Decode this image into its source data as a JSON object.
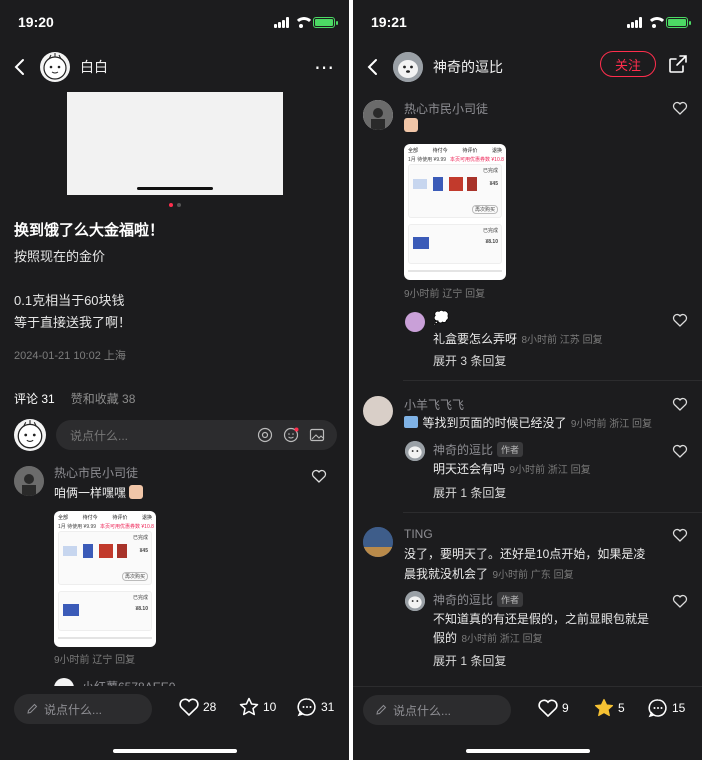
{
  "left": {
    "status": {
      "time": "19:20"
    },
    "nav": {
      "username": "白白"
    },
    "post": {
      "title": "换到饿了么大金福啦！",
      "lines": [
        "按照现在的金价",
        "",
        "0.1克相当于60块钱",
        "等于直接送我了啊！"
      ],
      "meta": "2024-01-21 10:02 上海"
    },
    "tabs": {
      "comments": "评论 31",
      "likes": "赞和收藏 38"
    },
    "comment_input_placeholder": "说点什么...",
    "comments": [
      {
        "name": "热心市民小司徒",
        "text": "咱俩一样嘿嘿",
        "meta": "9小时前 辽宁 回复"
      },
      {
        "name": "小红薯6578AEE0"
      }
    ],
    "shot": {
      "tabs": [
        "全部",
        "待付今",
        "待评价",
        "退换"
      ],
      "text1": "1月 待使用 ¥9.99",
      "text2": "本页可用优惠券数 ¥10.8",
      "text3": "已完成",
      "text4": "再次购买",
      "text5": "¥45",
      "text6": "¥8.10"
    },
    "bottom": {
      "say": "说点什么...",
      "likes": "28",
      "stars": "10",
      "comments": "31"
    }
  },
  "right": {
    "status": {
      "time": "19:21"
    },
    "nav": {
      "username": "神奇的逗比",
      "follow": "关注"
    },
    "comments": [
      {
        "name": "热心市民小司徒",
        "meta": "9小时前 辽宁 回复"
      },
      {
        "name": "",
        "text": "礼盒要怎么弄呀",
        "meta": "8小时前 江苏 回复",
        "expand": "展开 3 条回复"
      },
      {
        "name": "小羊飞飞飞",
        "text": "等找到页面的时候已经没了",
        "meta": "9小时前 浙江 回复"
      },
      {
        "name": "神奇的逗比",
        "tag": "作者",
        "text": "明天还会有吗",
        "meta": "9小时前 浙江 回复",
        "expand": "展开 1 条回复"
      },
      {
        "name": "TING",
        "text1": "没了，要明天了。还好是10点开始，如果是凌",
        "text2": "晨我就没机会了",
        "meta": "9小时前 广东 回复"
      },
      {
        "name": "神奇的逗比",
        "tag": "作者",
        "text1": "不知道真的有还是假的，之前显眼包就是",
        "text2": "假的",
        "meta": "8小时前 浙江 回复",
        "expand": "展开 1 条回复"
      }
    ],
    "bottom": {
      "say": "说点什么...",
      "likes": "9",
      "stars": "5",
      "comments": "15"
    }
  },
  "colors": {
    "accent": "#ff2e4d",
    "star_active": "#f5c133",
    "background": "#1c1c1e"
  }
}
